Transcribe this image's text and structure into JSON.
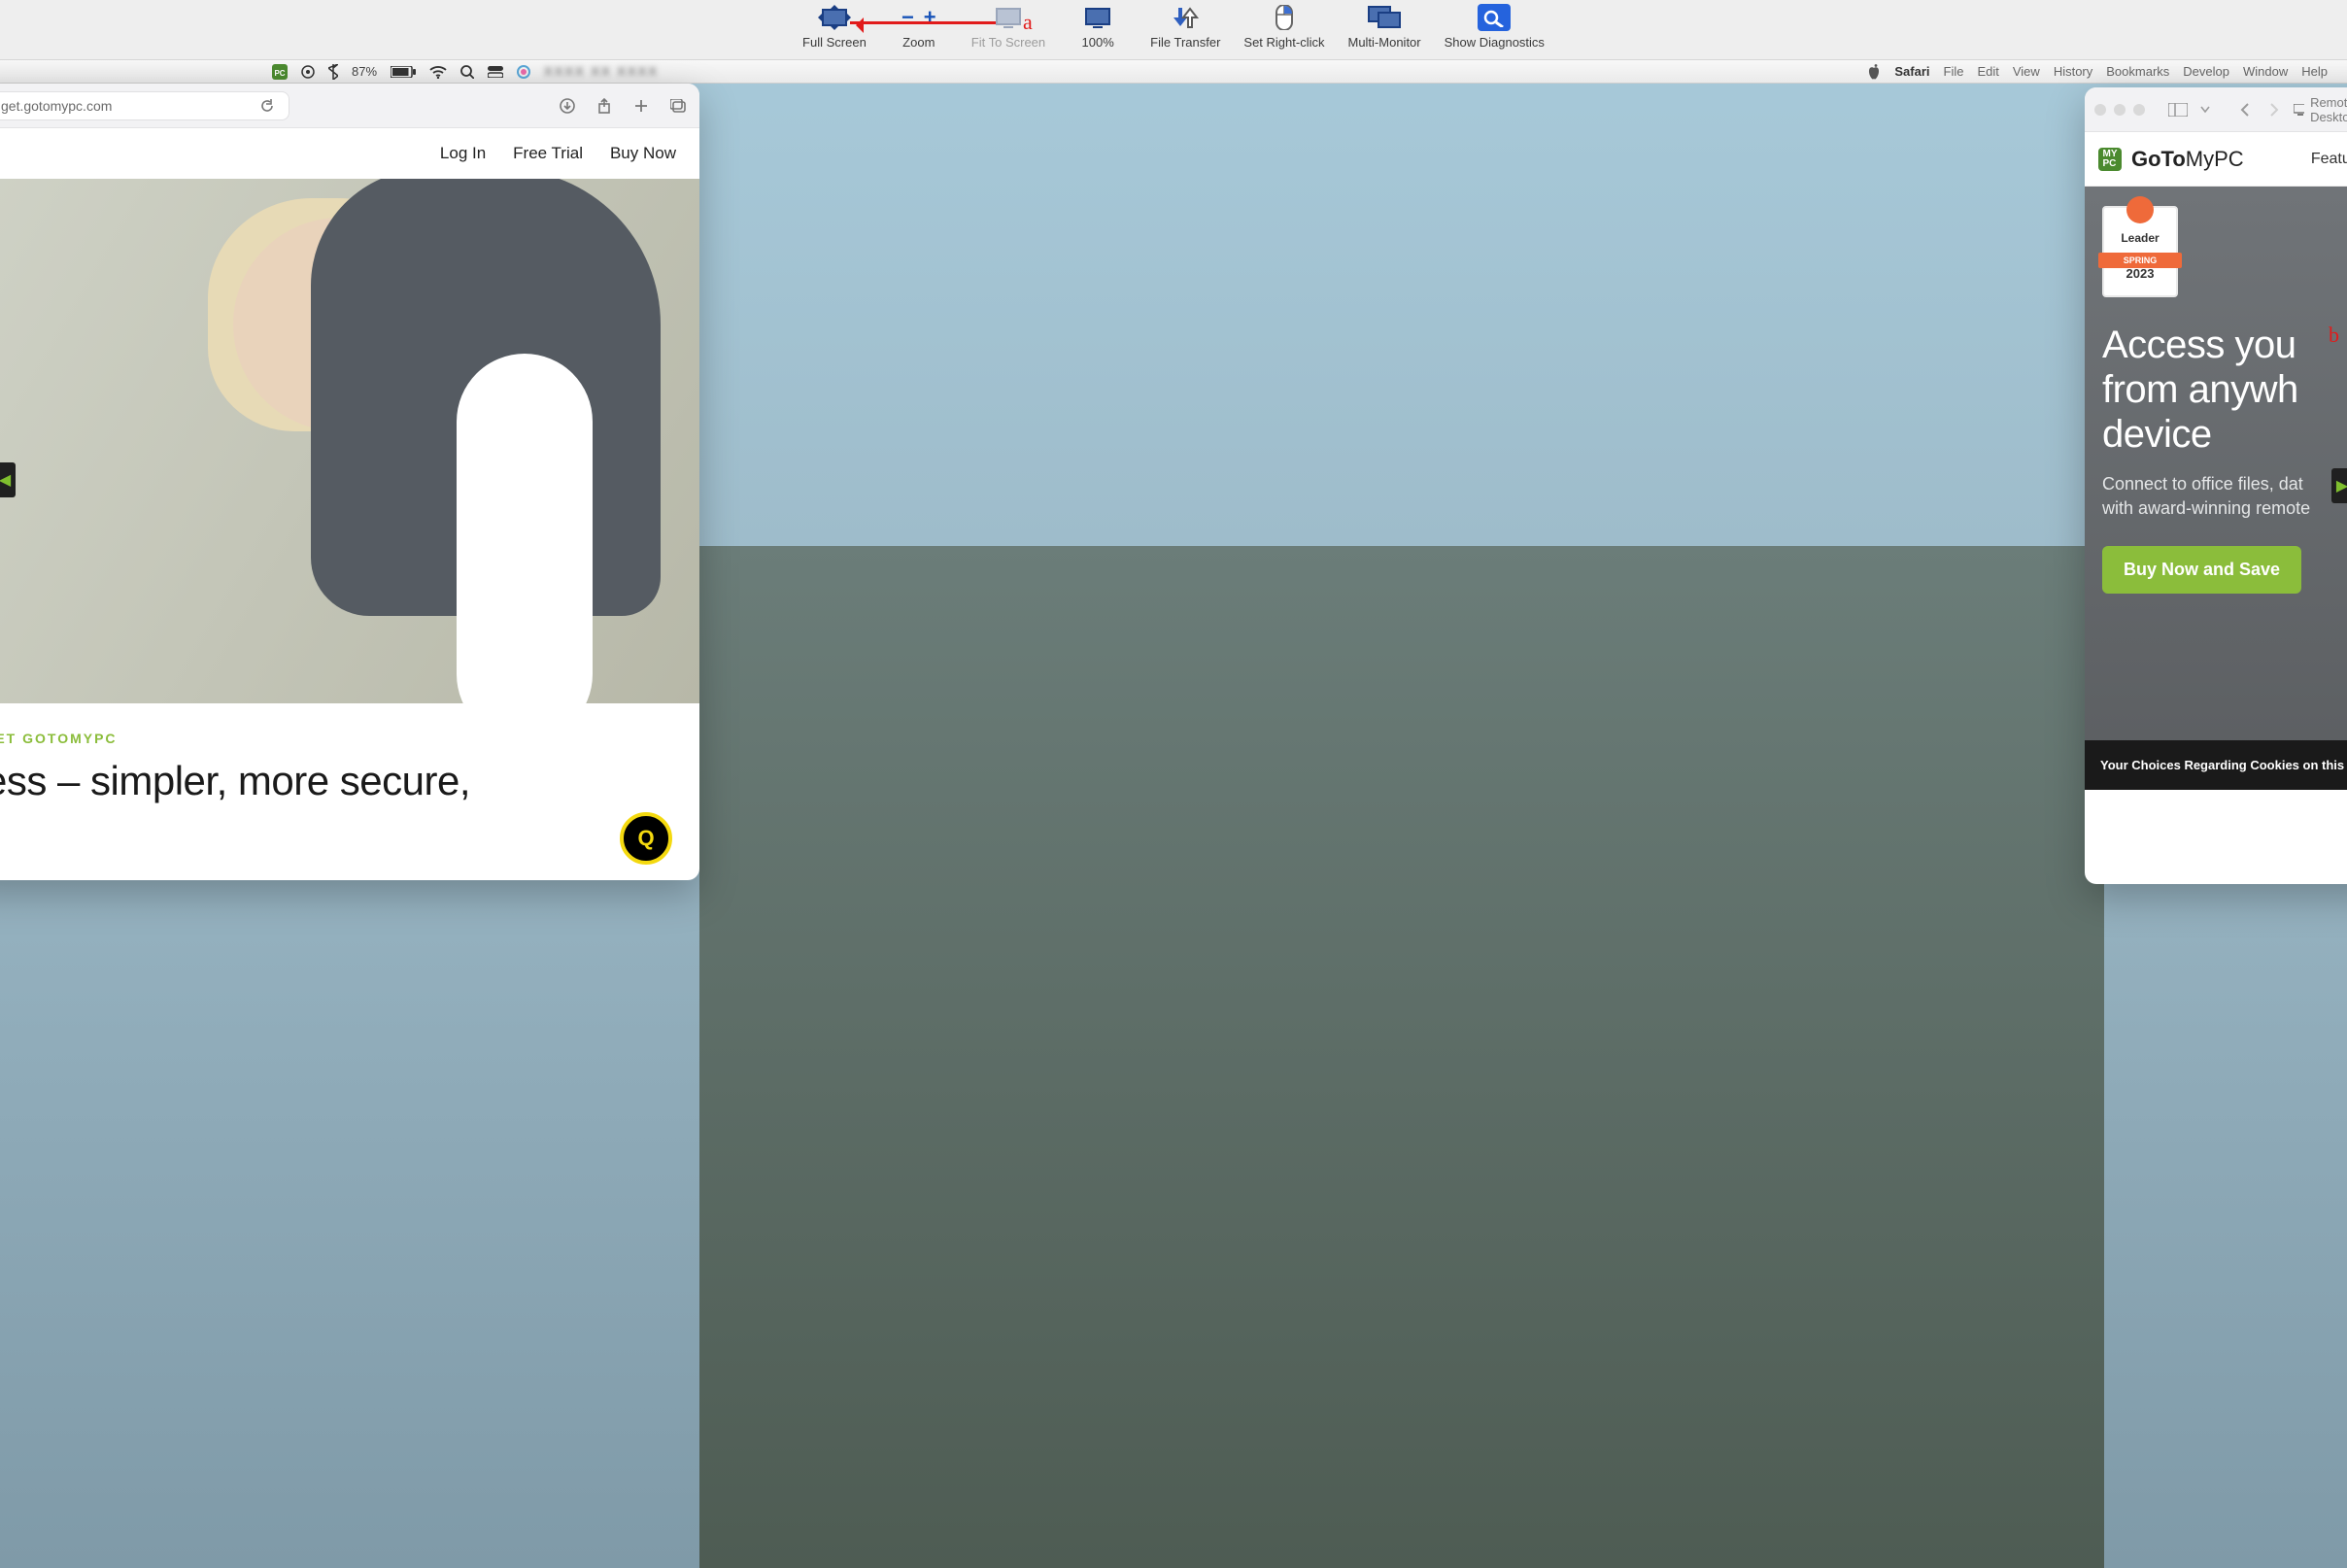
{
  "toolbar": {
    "full_screen": "Full Screen",
    "zoom": "Zoom",
    "fit": "Fit To Screen",
    "hundred": "100%",
    "transfer": "File Transfer",
    "right_click": "Set Right-click",
    "multi": "Multi-Monitor",
    "diagnostics": "Show Diagnostics"
  },
  "annot": {
    "a": "a",
    "b": "b"
  },
  "menubar": {
    "battery_pct": "87%",
    "apple": "",
    "app": "Safari",
    "items": [
      "File",
      "Edit",
      "View",
      "History",
      "Bookmarks",
      "Develop",
      "Window",
      "Help"
    ]
  },
  "left_win": {
    "url": "get.gotomypc.com",
    "nav": {
      "login": "Log In",
      "trial": "Free Trial",
      "buy": "Buy Now"
    },
    "meet": "EET GOTOMYPC",
    "headline": "ess – simpler, more secure,"
  },
  "right_win": {
    "remote_label": "Remote Deskto",
    "brand_1": "GoTo",
    "brand_2": "MyPC",
    "features": "Features",
    "badge_leader": "Leader",
    "badge_ribbon": "SPRING",
    "badge_year": "2023",
    "h1_l1": "Access you",
    "h1_l2": "from anywh",
    "h1_l3": "device",
    "sub_l1": "Connect to office files, dat",
    "sub_l2": "with award-winning remote",
    "cta": "Buy Now and Save",
    "cookie": "Your Choices Regarding Cookies on this Si"
  }
}
